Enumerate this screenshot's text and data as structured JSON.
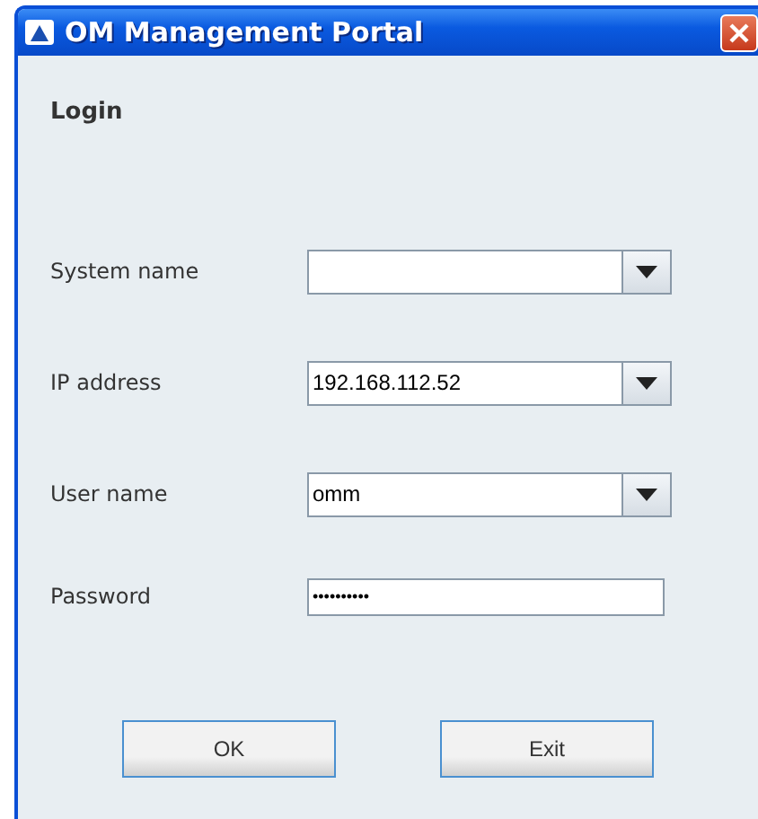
{
  "window": {
    "title": "OM Management Portal"
  },
  "heading": "Login",
  "fields": [
    {
      "label": "System name",
      "kind": "combo"
    },
    {
      "label": "IP address",
      "kind": "combo",
      "value": "192.168.112.52"
    },
    {
      "label": "User name",
      "kind": "combo",
      "value": "omm"
    },
    {
      "label": "Password",
      "kind": "password",
      "value": "••••••••••"
    }
  ],
  "buttons": [
    "OK",
    "Exit"
  ]
}
